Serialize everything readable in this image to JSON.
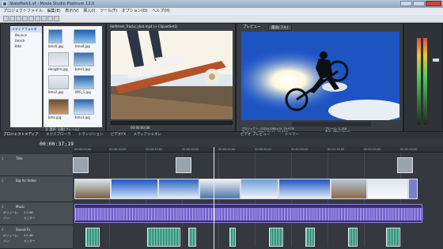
{
  "window": {
    "title": "StatePark1.vf - Movie Studio Platinum 12.0"
  },
  "menus": [
    "プロジェクトファイル",
    "編集(E)",
    "表示(V)",
    "挿入(I)",
    "ツール(T)",
    "オプション(O)",
    "ヘルプ(H)"
  ],
  "explorer": {
    "tree_items": [
      "メディアフォルダ",
      "Bounce",
      "Beach",
      "Bike"
    ],
    "thumbs": [
      "bmx6.jpg",
      "bmx8.jpg",
      "Hangtim.jpg",
      "bmx1.jpg",
      "bmx2.jpg",
      "IMG_1.jpg",
      "bmx.jpg",
      "bmx3.jpg"
    ],
    "status": "全 選択: 自動(フレーム)"
  },
  "trimmer": {
    "title": "Halfsteet_Tracks_shot.mp4 (+ ClipsetSet1)",
    "timecode": "00:00:00;00"
  },
  "preview": {
    "title": "プレビュー",
    "zoom": "最高(フル)",
    "info_lines": [
      "プロジェクト: 1920x1080x24, 29.970i",
      "プレビュー: 480x270x32, 29.970i"
    ],
    "frame": "フレーム: 1,118",
    "display": "表示: 480x270x32"
  },
  "tabs": {
    "left": [
      "プロジェクトメディア",
      "エクスプローラ",
      "トランジション",
      "ビデオFX",
      "メディアジェネレ"
    ],
    "right": [
      "ビデオ プレビュー",
      "トリマー"
    ]
  },
  "timeline": {
    "timecode": "00:00:37;19",
    "ruler": [
      "00:00:00;00",
      "00:00:10;00",
      "00:00:20;00",
      "00:00:30;00",
      "00:00:40;00",
      "00:00:50;00",
      "00:01:00;00",
      "00:01:10;00",
      "00:01:20;00",
      "00:01:30;00"
    ]
  },
  "tracks": [
    {
      "name": "Title",
      "num": "1"
    },
    {
      "name": "Big Air Video",
      "num": "2"
    },
    {
      "name": "Music",
      "num": "3",
      "vol": "ボリューム:",
      "vol_val": "0.0 dB",
      "pan": "パン:",
      "pan_val": "センター"
    },
    {
      "name": "Sound Fx",
      "num": "4",
      "vol": "ボリューム:",
      "vol_val": "0.0 dB",
      "pan": "パン:",
      "pan_val": "センター"
    }
  ],
  "colors": {
    "accent": "#6a5bc8",
    "audio": "#7a5ad0",
    "ruler": "#2f3338"
  }
}
